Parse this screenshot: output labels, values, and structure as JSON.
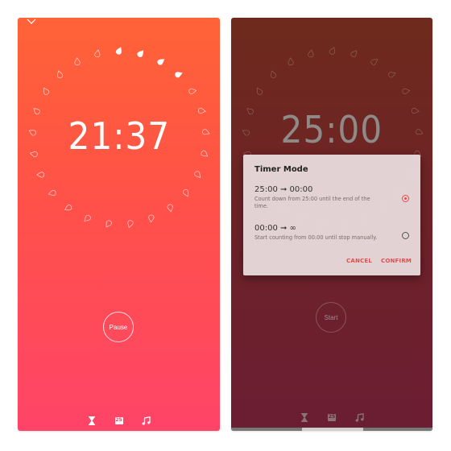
{
  "colors": {
    "accent": "#e84a4a",
    "left_bg_top": "#ff6337",
    "left_bg_bottom": "#ff4468",
    "right_bg_top": "#6e2a1c",
    "right_bg_bottom": "#6b1e33"
  },
  "left_screen": {
    "collapse_icon": "chevron-down-icon",
    "clock": "21:37",
    "timer_ring": {
      "total_drops": 25,
      "filled_drops": 4
    },
    "action_button": "Pause",
    "bottom_bar": {
      "icons": [
        "hourglass-icon",
        "calendar-icon",
        "music-note-icon"
      ],
      "calendar_day": "25"
    }
  },
  "right_screen": {
    "clock": "25:00",
    "timer_ring": {
      "total_drops": 25,
      "filled_drops": 0
    },
    "action_button": "Start",
    "bottom_bar": {
      "icons": [
        "hourglass-icon",
        "calendar-icon",
        "music-note-icon"
      ],
      "calendar_day": "25"
    },
    "dialog": {
      "title": "Timer Mode",
      "options": [
        {
          "label": "25:00 ➞ 00:00",
          "description": "Count down from 25:00 until the end of the time.",
          "selected": true
        },
        {
          "label": "00:00 ➞ ∞",
          "description": "Start counting from 00:00 until stop manually.",
          "selected": false
        }
      ],
      "cancel_label": "CANCEL",
      "confirm_label": "CONFIRM"
    }
  }
}
